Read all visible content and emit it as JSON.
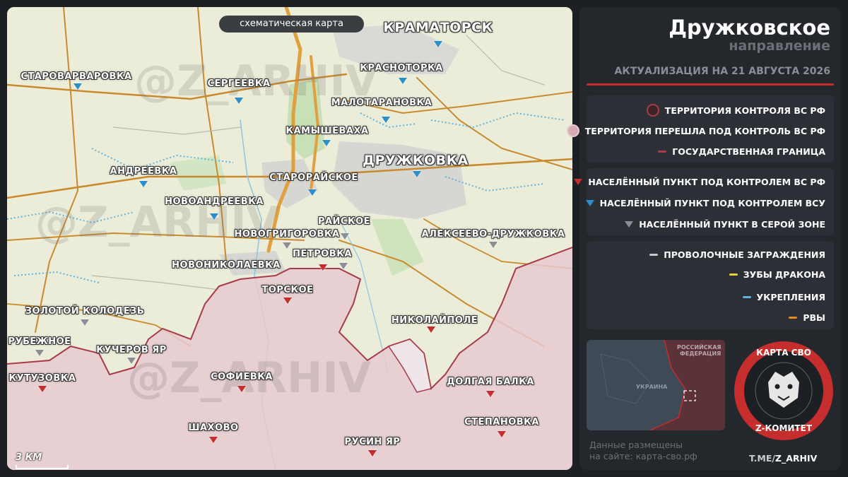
{
  "map": {
    "mode_tag": "схематическая карта",
    "scale_label": "3 КМ",
    "watermark": "@Z_ARHIV",
    "labels": {
      "kramatorsk": "КРАМАТОРСК",
      "starovarvarovka": "СТАРОВАРВАРОВКА",
      "sergeevka": "СЕРГЕЕВКА",
      "krasnotorka": "КРАСНОТОРКА",
      "malotaranovka": "МАЛОТАРАНОВКА",
      "kamyshevakha": "КАМЫШЕВАХА",
      "druzhkovka": "ДРУЖКОВКА",
      "andreevka": "АНДРЕЕВКА",
      "staroraiskoe": "СТАРОРАЙСКОЕ",
      "novoandreevka": "НОВОАНДРЕЕВКА",
      "raiskoe": "РАЙСКОЕ",
      "novogrigorovka": "НОВОГРИГОРОВКА",
      "alekseevo": "АЛЕКСЕЕВО-ДРУЖКОВКА",
      "petrovka": "ПЕТРОВКА",
      "novonikolaevka": "НОВОНИКОЛАЕВКА",
      "torskoe": "ТОРСКОЕ",
      "zolotoi": "ЗОЛОТОЙ КОЛОДЕЗЬ",
      "nikolaipole": "НИКОЛАЙПОЛЕ",
      "rubezhnoe": "РУБЕЖНОЕ",
      "kucherov": "КУЧЕРОВ ЯР",
      "kutuzovka": "КУТУЗОВКА",
      "sofievka": "СОФИЕВКА",
      "dolgaya": "ДОЛГАЯ БАЛКА",
      "shakhovo": "ШАХОВО",
      "stepanovka": "СТЕПАНОВКА",
      "rusin": "РУСИН ЯР"
    },
    "settlements": [
      {
        "name": "КРАМАТОРСК",
        "status": "ua"
      },
      {
        "name": "СТАРОВАРВАРОВКА",
        "status": "ua"
      },
      {
        "name": "СЕРГЕЕВКА",
        "status": "ua"
      },
      {
        "name": "КРАСНОТОРКА",
        "status": "ua"
      },
      {
        "name": "МАЛОТАРАНОВКА",
        "status": "ua"
      },
      {
        "name": "КАМЫШЕВАХА",
        "status": "ua"
      },
      {
        "name": "ДРУЖКОВКА",
        "status": "ua"
      },
      {
        "name": "АНДРЕЕВКА",
        "status": "ua"
      },
      {
        "name": "СТАРОРАЙСКОЕ",
        "status": "ua"
      },
      {
        "name": "НОВОАНДРЕЕВКА",
        "status": "ua"
      },
      {
        "name": "РАЙСКОЕ",
        "status": "grey"
      },
      {
        "name": "НОВОГРИГОРОВКА",
        "status": "grey"
      },
      {
        "name": "АЛЕКСЕЕВО-ДРУЖКОВКА",
        "status": "grey"
      },
      {
        "name": "ПЕТРОВКА",
        "status": "grey"
      },
      {
        "name": "НОВОНИКОЛАЕВКА",
        "status": "ru"
      },
      {
        "name": "ТОРСКОЕ",
        "status": "ru"
      },
      {
        "name": "ЗОЛОТОЙ КОЛОДЕЗЬ",
        "status": "grey"
      },
      {
        "name": "НИКОЛАЙПОЛЕ",
        "status": "ru"
      },
      {
        "name": "РУБЕЖНОЕ",
        "status": "grey"
      },
      {
        "name": "КУЧЕРОВ ЯР",
        "status": "grey"
      },
      {
        "name": "КУТУЗОВКА",
        "status": "ru"
      },
      {
        "name": "СОФИЕВКА",
        "status": "ru"
      },
      {
        "name": "ДОЛГАЯ БАЛКА",
        "status": "ru"
      },
      {
        "name": "ШАХОВО",
        "status": "ru"
      },
      {
        "name": "СТЕПАНОВКА",
        "status": "ru"
      },
      {
        "name": "РУСИН ЯР",
        "status": "ru"
      }
    ]
  },
  "panel": {
    "title": "Дружковское",
    "subtitle": "направление",
    "date_line": "АКТУАЛИЗАЦИЯ НА 21 АВГУСТА 2026",
    "legend": {
      "ru_territory": "ТЕРРИТОРИЯ КОНТРОЛЯ ВС РФ",
      "transferred": "ТЕРРИТОРИЯ ПЕРЕШЛА ПОД КОНТРОЛЬ ВС РФ",
      "border": "ГОСУДАРСТВЕННАЯ ГРАНИЦА",
      "ru_settlement": "НАСЕЛЁННЫЙ ПУНКТ ПОД КОНТРОЛЕМ ВС РФ",
      "ua_settlement": "НАСЕЛЁННЫЙ ПУНКТ ПОД КОНТРОЛЕМ ВСУ",
      "grey_settlement": "НАСЕЛЁННЫЙ ПУНКТ В СЕРОЙ ЗОНЕ",
      "wire": "ПРОВОЛОЧНЫЕ ЗАГРАЖДЕНИЯ",
      "dragon": "ЗУБЫ ДРАКОНА",
      "fort": "УКРЕПЛЕНИЯ",
      "ditch": "РВЫ"
    },
    "minimap": {
      "russia_label_1": "РОССИЙСКАЯ",
      "russia_label_2": "ФЕДЕРАЦИЯ",
      "ukraine_label": "УКРАИНА"
    },
    "site_note_1": "Данные размещены",
    "site_note_2": "на сайте: карта-сво.рф",
    "logo_top": "КАРТА СВО",
    "logo_bottom": "Z-КОМИТЕТ",
    "tg_prefix": "T.ME/",
    "tg_handle": "Z_ARHIV"
  },
  "colors": {
    "ru_fill": "#e8c9cf",
    "ru_front": "#a83a4a",
    "ua_marker": "#2b8fc9",
    "ru_marker": "#c62d2d",
    "grey_marker": "#8a8f96",
    "road": "#c98a2e",
    "wire": "#c9c9c9",
    "dragon": "#e8d23a",
    "fort": "#5fb3e0",
    "ditch": "#e08a2a"
  }
}
